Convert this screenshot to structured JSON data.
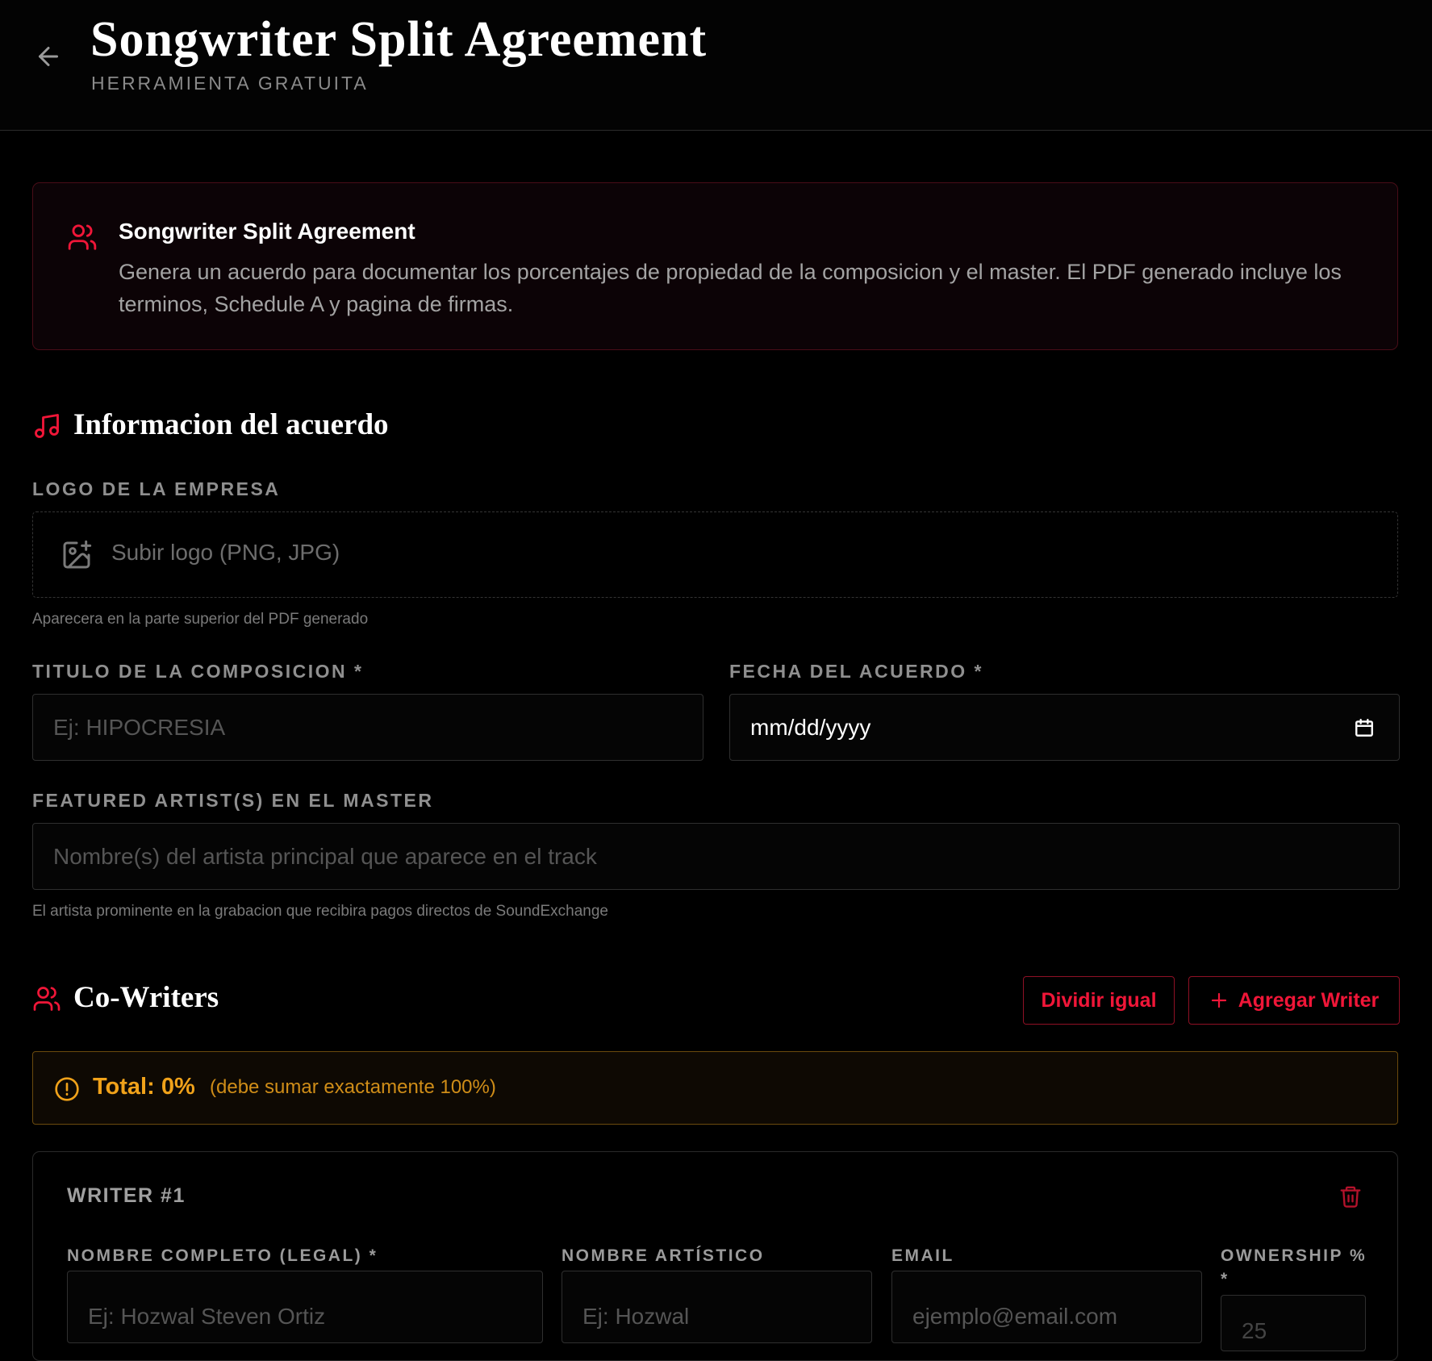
{
  "header": {
    "title": "Songwriter Split Agreement",
    "subtitle": "HERRAMIENTA GRATUITA"
  },
  "info": {
    "title": "Songwriter Split Agreement",
    "text": "Genera un acuerdo para documentar los porcentajes de propiedad de la composicion y el master. El PDF generado incluye los terminos, Schedule A y pagina de firmas."
  },
  "agreement": {
    "title": "Informacion del acuerdo",
    "logo_label": "LOGO DE LA EMPRESA",
    "logo_upload": "Subir logo (PNG, JPG)",
    "logo_hint": "Aparecera en la parte superior del PDF generado",
    "composition_label": "TITULO DE LA COMPOSICION *",
    "composition_placeholder": "Ej: HIPOCRESIA",
    "date_label": "FECHA DEL ACUERDO *",
    "date_value": "mm/dd/yyyy",
    "featured_label": "FEATURED ARTIST(S) EN EL MASTER",
    "featured_placeholder": "Nombre(s) del artista principal que aparece en el track",
    "featured_hint": "El artista prominente en la grabacion que recibira pagos directos de SoundExchange"
  },
  "cowriters": {
    "title": "Co-Writers",
    "split_button": "Dividir igual",
    "add_button": "Agregar Writer",
    "total": "Total: 0%",
    "total_note": "(debe sumar exactamente 100%)",
    "writer": {
      "title": "WRITER #1",
      "legal_name_label": "NOMBRE COMPLETO (LEGAL) *",
      "legal_name_placeholder": "Ej: Hozwal Steven Ortiz",
      "artist_name_label": "NOMBRE ARTÍSTICO",
      "artist_name_placeholder": "Ej: Hozwal",
      "email_label": "EMAIL",
      "email_placeholder": "ejemplo@email.com",
      "ownership_label": "OWNERSHIP %",
      "ownership_required": "*",
      "ownership_placeholder": "25"
    }
  },
  "colors": {
    "accent": "#f01638",
    "warning": "#f0a21a",
    "background": "#000000"
  },
  "icons": [
    "arrow-left-icon",
    "users-icon",
    "music-icon",
    "image-plus-icon",
    "calendar-icon",
    "plus-icon",
    "alert-circle-icon",
    "trash-icon"
  ]
}
